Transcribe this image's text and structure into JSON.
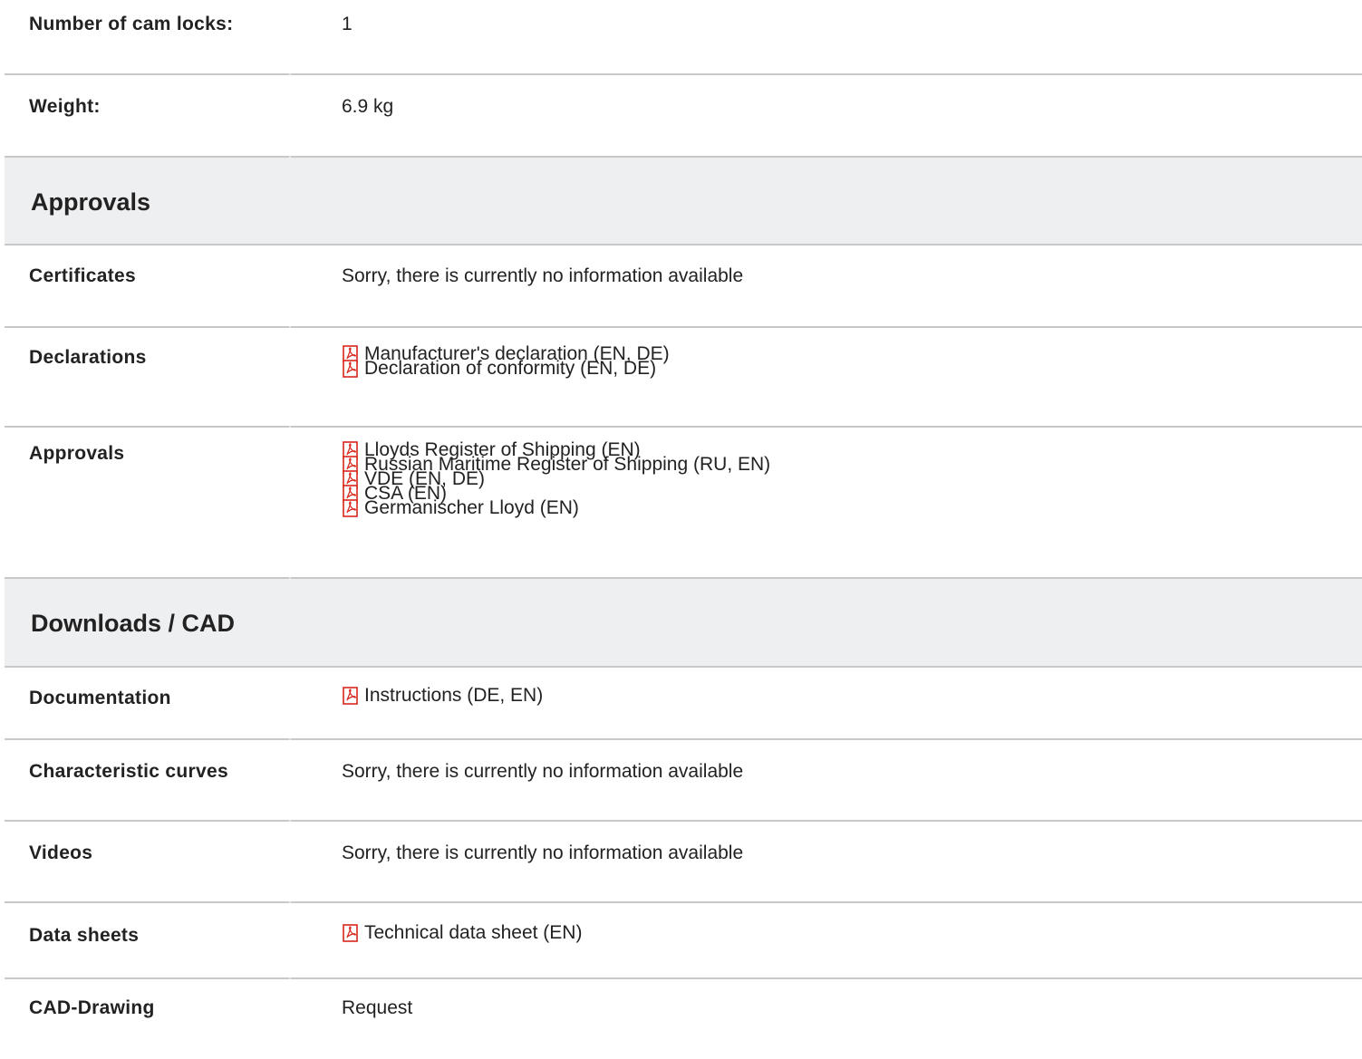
{
  "top_rows": [
    {
      "label": "Number of cam locks:",
      "value": "1"
    },
    {
      "label": "Weight:",
      "value": "6.9 kg"
    }
  ],
  "approvals_section": {
    "title": "Approvals",
    "certificates": {
      "label": "Certificates",
      "value": "Sorry, there is currently no information available"
    },
    "declarations": {
      "label": "Declarations",
      "files": [
        "Manufacturer's declaration (EN, DE)",
        "Declaration of conformity (EN, DE)"
      ]
    },
    "approvals": {
      "label": "Approvals",
      "files": [
        "Lloyds Register of Shipping (EN)",
        "Russian Maritime Register of Shipping (RU, EN)",
        "VDE (EN, DE)",
        "CSA (EN)",
        "Germanischer Lloyd (EN)"
      ]
    }
  },
  "downloads_section": {
    "title": "Downloads / CAD",
    "documentation": {
      "label": "Documentation",
      "files": [
        "Instructions (DE, EN)"
      ]
    },
    "characteristic_curves": {
      "label": "Characteristic curves",
      "value": "Sorry, there is currently no information available"
    },
    "videos": {
      "label": "Videos",
      "value": "Sorry, there is currently no information available"
    },
    "data_sheets": {
      "label": "Data sheets",
      "files": [
        "Technical data sheet (EN)"
      ]
    },
    "cad_drawing": {
      "label": "CAD-Drawing",
      "value": "Request"
    }
  },
  "colors": {
    "section_background": "#eeeff1",
    "divider": "#c8c8c8",
    "pdf_icon_red": "#d9261c"
  },
  "icons": {
    "file": "pdf-icon"
  }
}
